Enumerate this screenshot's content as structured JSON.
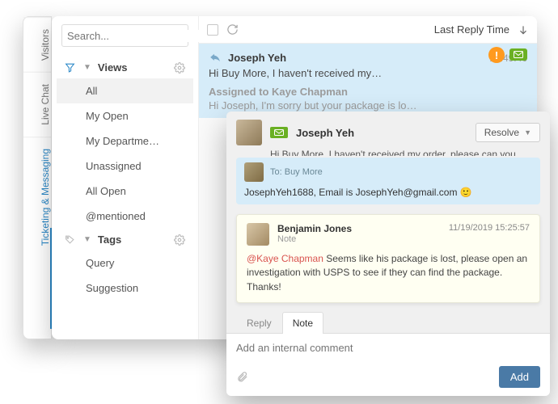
{
  "vtabs": {
    "visitors": "Visitors",
    "livechat": "Live Chat",
    "ticketing": "Ticketing & Messaging"
  },
  "sidebar": {
    "search_placeholder": "Search...",
    "views": {
      "label": "Views",
      "items": [
        "All",
        "My Open",
        "My Departme…",
        "Unassigned",
        "All Open",
        "@mentioned"
      ]
    },
    "tags": {
      "label": "Tags",
      "items": [
        "Query",
        "Suggestion"
      ]
    }
  },
  "list": {
    "sort_label": "Last Reply Time",
    "item": {
      "sender": "Joseph Yeh",
      "time": "10:49:40",
      "preview": "Hi Buy More, I haven't received my…",
      "assigned": "Assigned to Kaye Chapman",
      "reply_preview": "Hi Joseph, I'm sorry but your package is lo…"
    }
  },
  "ticket": {
    "sender": "Joseph Yeh",
    "subject": "Hi Buy More, I haven't received my order, please can you …",
    "resolve_label": "Resolve",
    "message": {
      "to_label": "To: Buy More",
      "body": "JosephYeh1688, Email is JosephYeh@gmail.com 🙂"
    },
    "note": {
      "author": "Benjamin Jones",
      "kind": "Note",
      "timestamp": "11/19/2019 15:25:57",
      "mention": "@Kaye Chapman",
      "body": " Seems like his package is lost, please open an investigation with USPS to see if they can find the package. Thanks!"
    },
    "tabs": {
      "reply": "Reply",
      "note": "Note"
    },
    "composer_placeholder": "Add an internal comment",
    "add_label": "Add"
  }
}
